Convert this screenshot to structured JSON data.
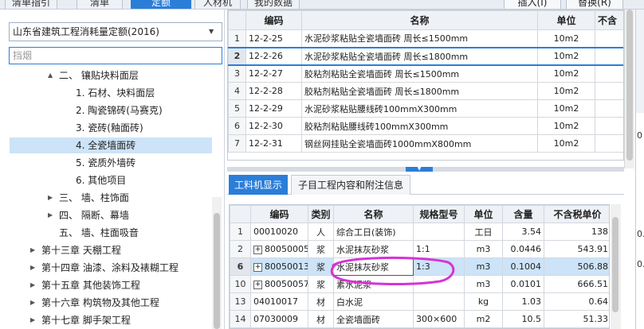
{
  "top_tabs": [
    {
      "label": "清单指引",
      "active": false
    },
    {
      "label": "清单",
      "active": false
    },
    {
      "label": "定额",
      "active": true
    },
    {
      "label": "人材机",
      "active": false
    },
    {
      "label": "我的数据",
      "active": false
    }
  ],
  "top_buttons": [
    {
      "label": "插入(I)"
    },
    {
      "label": "替换(R)"
    }
  ],
  "left_panel": {
    "quota_library": "山东省建筑工程消耗量定额(2016)",
    "search_placeholder": "挡烟",
    "tree": [
      {
        "label": "二、 镶贴块料面层",
        "expand": "▲",
        "selected": false
      },
      {
        "label": "1. 石材、块料面层",
        "expand": "",
        "selected": false
      },
      {
        "label": "2. 陶瓷锦砖(马赛克)",
        "expand": "",
        "selected": false
      },
      {
        "label": "3. 瓷砖(釉面砖)",
        "expand": "",
        "selected": false
      },
      {
        "label": "4. 全瓷墙面砖",
        "expand": "",
        "selected": true
      },
      {
        "label": "5. 瓷质外墙砖",
        "expand": "",
        "selected": false
      },
      {
        "label": "6. 其他项目",
        "expand": "",
        "selected": false
      },
      {
        "label": "三、 墙、柱饰面",
        "expand": "▶",
        "selected": false
      },
      {
        "label": "四、 隔断、幕墙",
        "expand": "▶",
        "selected": false
      },
      {
        "label": "五、 墙、柱面吸音",
        "expand": "",
        "selected": false
      },
      {
        "label": "第十三章 天棚工程",
        "expand": "▶",
        "selected": false
      },
      {
        "label": "第十四章 油漆、涂料及裱糊工程",
        "expand": "▶",
        "selected": false
      },
      {
        "label": "第十五章 其他装饰工程",
        "expand": "▶",
        "selected": false
      },
      {
        "label": "第十六章 构筑物及其他工程",
        "expand": "▶",
        "selected": false
      },
      {
        "label": "第十七章 脚手架工程",
        "expand": "▶",
        "selected": false
      },
      {
        "label": "第十八章 模板工程",
        "expand": "▶",
        "selected": false
      }
    ]
  },
  "upper_grid": {
    "headers": [
      "",
      "编码",
      "名称",
      "单位",
      "不含"
    ],
    "rows": [
      {
        "n": "1",
        "code": "12-2-25",
        "name": "水泥砂浆粘贴全瓷墙面砖  周长≤1500mm",
        "unit": "10m2"
      },
      {
        "n": "2",
        "code": "12-2-26",
        "name": "水泥砂浆粘贴全瓷墙面砖  周长≤1800mm",
        "unit": "10m2"
      },
      {
        "n": "3",
        "code": "12-2-27",
        "name": "胶粘剂粘贴全瓷墙面砖  周长≤1500mm",
        "unit": "10m2"
      },
      {
        "n": "4",
        "code": "12-2-28",
        "name": "胶粘剂粘贴全瓷墙面砖  周长≤1800mm",
        "unit": "10m2"
      },
      {
        "n": "5",
        "code": "12-2-29",
        "name": "水泥砂浆粘贴腰线砖100mmX300mm",
        "unit": "10m2"
      },
      {
        "n": "6",
        "code": "12-2-30",
        "name": "胶粘剂粘贴腰线砖100mmX300mm",
        "unit": "10m2"
      },
      {
        "n": "7",
        "code": "12-2-31",
        "name": "钢丝网挂贴全瓷墙面砖1000mmX800mm",
        "unit": "10m2"
      }
    ]
  },
  "lower_tabs": [
    {
      "label": "工料机显示",
      "active": true
    },
    {
      "label": "子目工程内容和附注信息",
      "active": false
    }
  ],
  "lower_grid": {
    "headers": [
      "",
      "编码",
      "类别",
      "名称",
      "规格型号",
      "单位",
      "含量",
      "不含税单价"
    ],
    "rows": [
      {
        "n": "1",
        "expand": false,
        "code": "00010020",
        "cat": "人",
        "name": "综合工日(装饰)",
        "spec": "",
        "unit": "工日",
        "qty": "3.54",
        "price": "138"
      },
      {
        "n": "2",
        "expand": true,
        "code": "80050005",
        "cat": "浆",
        "name": "水泥抹灰砂浆",
        "spec": "1:1",
        "unit": "m3",
        "qty": "0.0446",
        "price": "543.91"
      },
      {
        "n": "6",
        "expand": true,
        "code": "80050013",
        "cat": "浆",
        "name": "水泥抹灰砂浆",
        "spec": "1:3",
        "unit": "m3",
        "qty": "0.1004",
        "price": "506.88"
      },
      {
        "n": "10",
        "expand": true,
        "code": "80050057",
        "cat": "浆",
        "name": "素水泥浆",
        "spec": "",
        "unit": "m3",
        "qty": "0.0101",
        "price": "666.51"
      },
      {
        "n": "13",
        "expand": false,
        "code": "04010017",
        "cat": "材",
        "name": "白水泥",
        "spec": "",
        "unit": "kg",
        "qty": "1.03",
        "price": "0.64"
      },
      {
        "n": "14",
        "expand": false,
        "code": "07030009",
        "cat": "材",
        "name": "全瓷墙面砖",
        "spec": "300×600",
        "unit": "m2",
        "qty": "10.5",
        "price": "51.33"
      }
    ]
  },
  "right_edge": {
    "values": [
      "0",
      "0.",
      "0."
    ]
  },
  "colors": {
    "accent": "#2b7ed8",
    "selected_row": "#cde3f7",
    "annotation": "#d633d6"
  }
}
